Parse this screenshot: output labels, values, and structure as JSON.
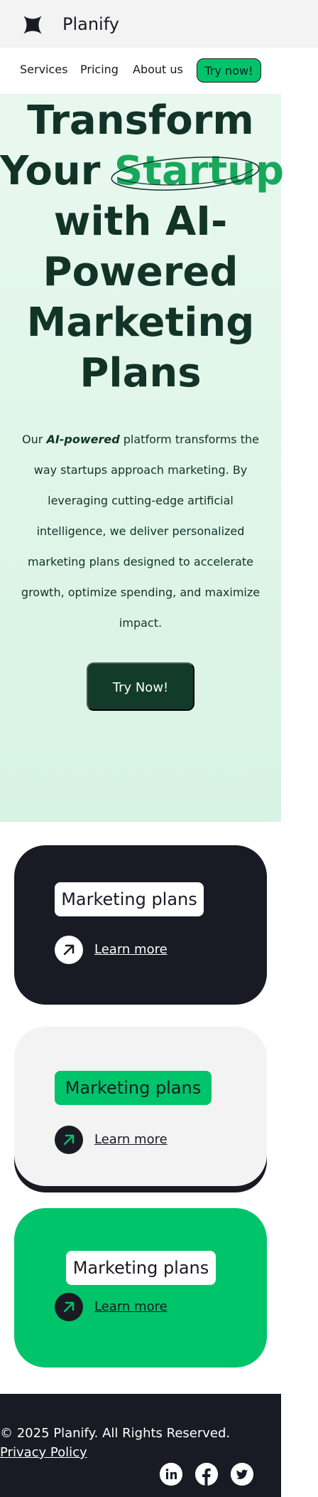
{
  "header": {
    "logo_icon": "star-icon",
    "brand": "Planify"
  },
  "nav": {
    "services": "Services",
    "pricing": "Pricing",
    "about": "About us",
    "cta": "Try now!"
  },
  "hero": {
    "title_line_1": "Transform",
    "title_line_2_prefix": "Your ",
    "title_highlight": "Startup",
    "title_line_3": "with AI-",
    "title_line_4": "Powered",
    "title_line_5": "Marketing",
    "title_line_6": "Plans",
    "text_prefix": "Our ",
    "text_emphasis": "AI-powered",
    "text_rest": " platform transforms the way startups approach marketing. By leveraging cutting-edge artificial intelligence, we deliver personalized marketing plans designed to accelerate growth, optimize spending, and maximize impact.",
    "button": "Try Now!"
  },
  "cards": [
    {
      "title": "Marketing plans",
      "link": "Learn more",
      "icon": "arrow-up-right-icon"
    },
    {
      "title": "Marketing plans",
      "link": "Learn more",
      "icon": "arrow-up-right-icon"
    },
    {
      "title": "Marketing plans",
      "link": "Learn more",
      "icon": "arrow-up-right-icon"
    }
  ],
  "footer": {
    "copyright": "© 2025 Planify. All Rights Reserved.",
    "privacy": "Privacy Policy",
    "socials": [
      "linkedin-icon",
      "facebook-icon",
      "twitter-icon"
    ]
  },
  "colors": {
    "brand_green": "#00c46a",
    "dark": "#191a23",
    "hero_dark": "#123b2c",
    "light_gray": "#f3f3f3"
  }
}
